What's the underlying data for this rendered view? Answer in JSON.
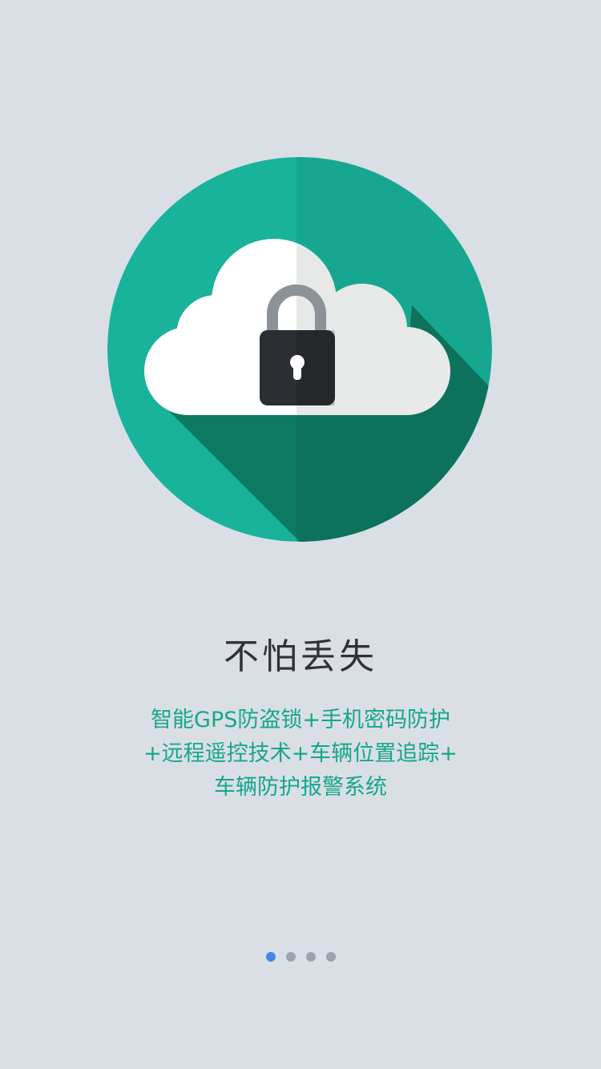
{
  "onboarding": {
    "title": "不怕丢失",
    "description_lines": [
      "智能GPS防盗锁+手机密码防护",
      "+远程遥控技术+车辆位置追踪+",
      "车辆防护报警系统"
    ],
    "illustration": {
      "icon": "cloud-lock-icon",
      "colors": {
        "circle": "#19b29a",
        "shadow": "#0d7a62",
        "cloud": "#ffffff",
        "lock_body": "#2b2f33",
        "shackle": "#8c9296"
      }
    }
  },
  "pager": {
    "count": 4,
    "active_index": 0,
    "colors": {
      "active": "#3d87e8",
      "inactive": "#9aa3ae"
    }
  }
}
